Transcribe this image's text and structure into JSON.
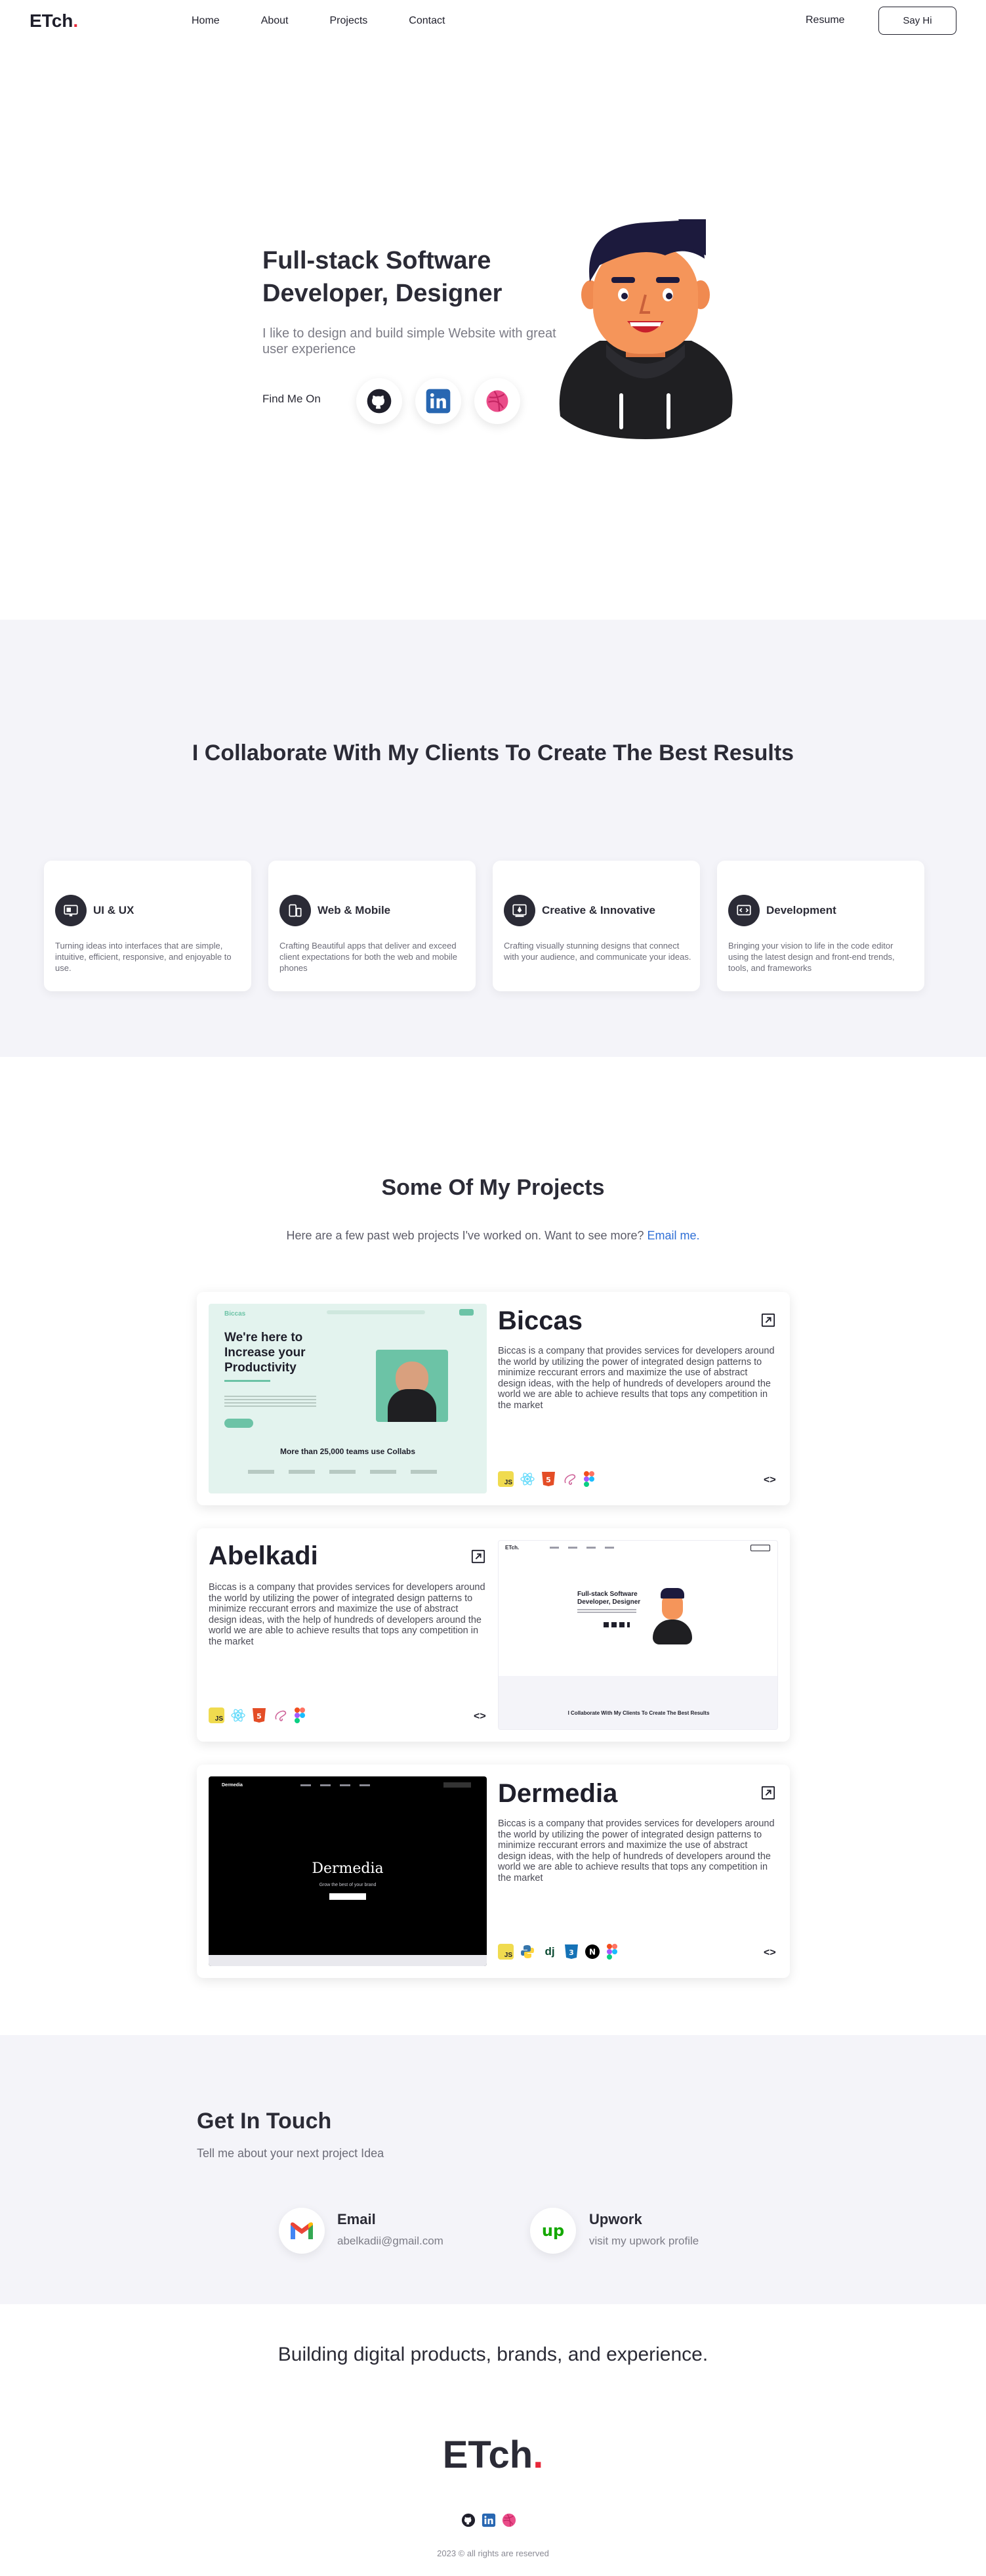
{
  "nav": {
    "logo": "ETch",
    "logo_dot": ".",
    "links": [
      "Home",
      "About",
      "Projects",
      "Contact"
    ],
    "resume": "Resume",
    "cta": "Say Hi"
  },
  "hero": {
    "title": "Full-stack Software Developer, Designer",
    "subtitle": "I like to design and build simple Website with great user experience",
    "find_me": "Find Me On",
    "socials": [
      "github-icon",
      "linkedin-icon",
      "dribbble-icon"
    ]
  },
  "collab": {
    "title": "I Collaborate With My Clients To Create The Best Results",
    "cards": [
      {
        "title": "UI & UX",
        "desc": "Turning ideas into interfaces that are simple, intuitive, efficient, responsive, and enjoyable to use."
      },
      {
        "title": "Web & Mobile",
        "desc": "Crafting Beautiful apps that deliver and exceed client expectations for both the web and mobile phones"
      },
      {
        "title": "Creative & Innovative",
        "desc": "Crafting visually stunning designs that connect with your audience, and communicate your ideas."
      },
      {
        "title": "Development",
        "desc": "Bringing your vision to life in the code editor using the latest design and front-end trends, tools, and frameworks"
      }
    ]
  },
  "projects": {
    "title": "Some Of My Projects",
    "subtitle": "Here are a few past web projects I've worked on. Want to see more?",
    "email_link": "Email me.",
    "code_symbol": "<>",
    "items": [
      {
        "name": "Biccas",
        "desc": "Biccas is a company that provides services for developers around the world by utilizing the power of integrated design patterns to minimize reccurant errors and maximize the use of abstract design ideas, with the help of hundreds of developers around the world we are able to achieve results that tops any competition in the market",
        "shot": {
          "brand": "Biccas",
          "headline": "We're here to Increase your Productivity",
          "stat": "More than 25,000 teams use Collabs"
        }
      },
      {
        "name": "Abelkadi",
        "desc": "Biccas is a company that provides services for developers around the world by utilizing the power of integrated design patterns to minimize reccurant errors and maximize the use of abstract design ideas, with the help of hundreds of developers around the world we are able to achieve results that tops any competition in the market",
        "shot": {
          "brand": "ETch.",
          "headline": "Full-stack Software Developer, Designer",
          "footer": "I Collaborate With My Clients To Create The Best Results"
        }
      },
      {
        "name": "Dermedia",
        "desc": "Biccas is a company that provides services for developers around the world by utilizing the power of integrated design patterns to minimize reccurant errors and maximize the use of abstract design ideas, with the help of hundreds of developers around the world we are able to achieve results that tops any competition in the market",
        "shot": {
          "brand": "Dermedia",
          "headline": "Dermedia",
          "tagline": "Grow the best of your brand"
        }
      }
    ]
  },
  "contact": {
    "title": "Get In Touch",
    "subtitle": "Tell me about your next project Idea",
    "email_label": "Email",
    "email_value": "abelkadii@gmail.com",
    "upwork_label": "Upwork",
    "upwork_value": "visit my upwork profile"
  },
  "footer": {
    "tagline": "Building digital products, brands, and experience.",
    "logo": "ETch",
    "logo_dot": ".",
    "copyright": "2023 © all rights are reserved"
  },
  "colors": {
    "accent_red": "#e8283a",
    "link_blue": "#2f6fd6",
    "section_bg": "#f4f4f9",
    "biccas_green": "#6cc3a6"
  }
}
